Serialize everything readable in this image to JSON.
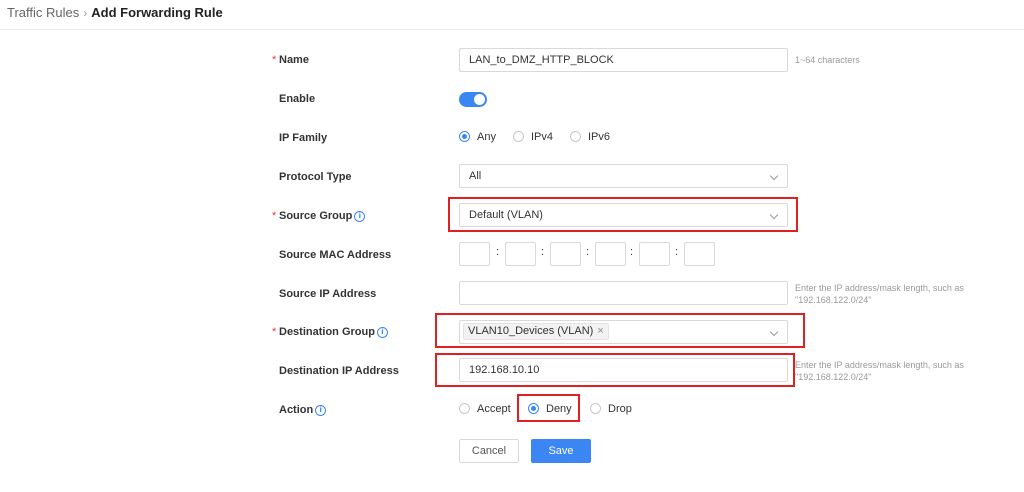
{
  "breadcrumb": {
    "parent": "Traffic Rules",
    "separator": "›",
    "current": "Add Forwarding Rule"
  },
  "form": {
    "name": {
      "label": "Name",
      "required": "*",
      "value": "LAN_to_DMZ_HTTP_BLOCK",
      "hint": "1~64 characters"
    },
    "enable": {
      "label": "Enable",
      "on": true
    },
    "ip_family": {
      "label": "IP Family",
      "options": [
        "Any",
        "IPv4",
        "IPv6"
      ],
      "selected": "Any"
    },
    "protocol_type": {
      "label": "Protocol Type",
      "value": "All"
    },
    "source_group": {
      "label": "Source Group",
      "required": "*",
      "info": "i",
      "value": "Default (VLAN)"
    },
    "source_mac": {
      "label": "Source MAC Address",
      "separator": ":"
    },
    "source_ip": {
      "label": "Source IP Address",
      "value": "",
      "hint_line1": "Enter the IP address/mask length, such as",
      "hint_line2": "\"192.168.122.0/24\""
    },
    "destination_group": {
      "label": "Destination Group",
      "required": "*",
      "info": "i",
      "tag": "VLAN10_Devices (VLAN)",
      "tag_close": "×"
    },
    "destination_ip": {
      "label": "Destination IP Address",
      "value": "192.168.10.10",
      "hint_line1": "Enter the IP address/mask length, such as",
      "hint_line2": "\"192.168.122.0/24\""
    },
    "action": {
      "label": "Action",
      "info": "i",
      "options": [
        "Accept",
        "Deny",
        "Drop"
      ],
      "selected": "Deny"
    }
  },
  "buttons": {
    "cancel": "Cancel",
    "save": "Save"
  },
  "colors": {
    "accent": "#3b86f2",
    "highlight": "#e02020",
    "required": "#e33333"
  }
}
